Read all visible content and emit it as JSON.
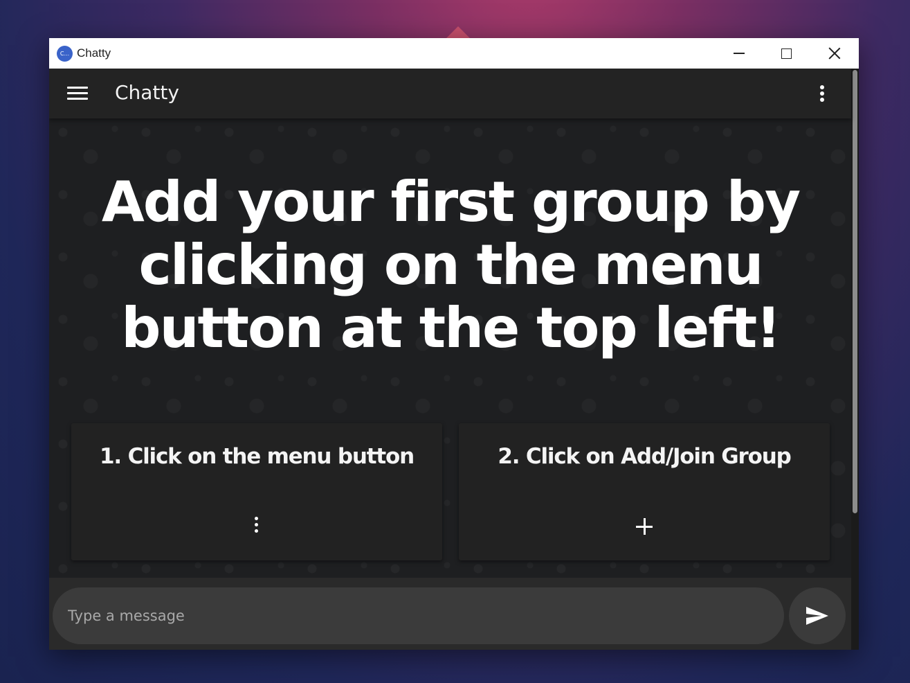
{
  "window": {
    "title": "Chatty",
    "icon_text": "C..."
  },
  "appbar": {
    "title": "Chatty"
  },
  "main": {
    "headline": "Add your first group by clicking on the menu button at the top left!",
    "cards": [
      {
        "label": "1. Click on the menu button",
        "icon": "more-vert-icon"
      },
      {
        "label": "2. Click on Add/Join Group",
        "icon": "plus-icon"
      }
    ]
  },
  "composer": {
    "placeholder": "Type a message",
    "send_icon": "send-icon"
  },
  "colors": {
    "appbar": "#232323",
    "content_bg": "#1e1f21",
    "card_bg": "#222222",
    "text": "#ffffff"
  }
}
